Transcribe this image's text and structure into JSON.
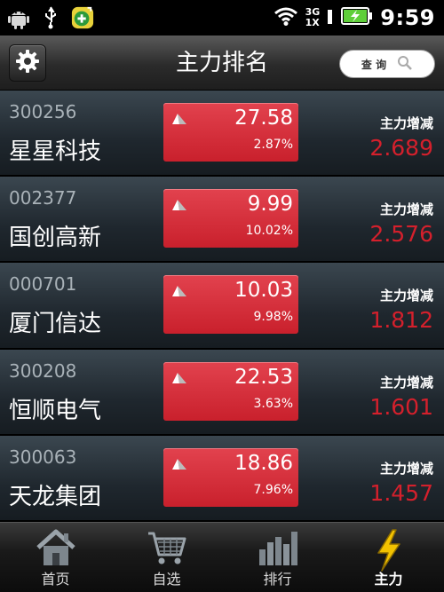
{
  "status_bar": {
    "network_top": "3G",
    "network_bottom": "1X",
    "time": "9:59"
  },
  "header": {
    "title": "主力排名",
    "search_label": "查 询"
  },
  "stocks": [
    {
      "code": "300256",
      "name": "星星科技",
      "price": "27.58",
      "change_pct": "2.87%",
      "flow_label": "主力增减",
      "flow_value": "2.689"
    },
    {
      "code": "002377",
      "name": "国创高新",
      "price": "9.99",
      "change_pct": "10.02%",
      "flow_label": "主力增减",
      "flow_value": "2.576"
    },
    {
      "code": "000701",
      "name": "厦门信达",
      "price": "10.03",
      "change_pct": "9.98%",
      "flow_label": "主力增减",
      "flow_value": "1.812"
    },
    {
      "code": "300208",
      "name": "恒顺电气",
      "price": "22.53",
      "change_pct": "3.63%",
      "flow_label": "主力增减",
      "flow_value": "1.601"
    },
    {
      "code": "300063",
      "name": "天龙集团",
      "price": "18.86",
      "change_pct": "7.96%",
      "flow_label": "主力增减",
      "flow_value": "1.457"
    }
  ],
  "tabs": [
    {
      "label": "首页",
      "icon": "home-icon"
    },
    {
      "label": "自选",
      "icon": "cart-icon"
    },
    {
      "label": "排行",
      "icon": "bar-chart-icon"
    },
    {
      "label": "主力",
      "icon": "lightning-icon"
    }
  ],
  "colors": {
    "up_red": "#d4202c",
    "price_box": "#d92f3a",
    "active_tab_icon": "#f2c200"
  }
}
